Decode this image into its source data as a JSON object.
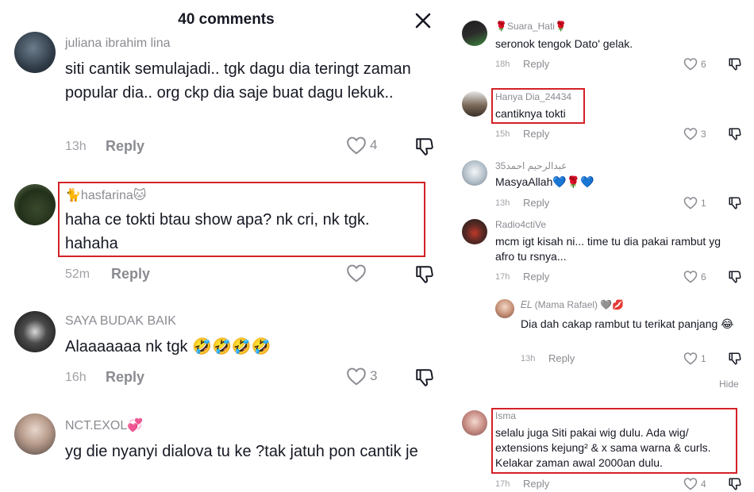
{
  "left": {
    "header_title": "40 comments",
    "comments": [
      {
        "username": "juliana ibrahim lina",
        "text": "siti cantik semulajadi.. tgk dagu dia teringt zaman popular dia.. org ckp dia saje buat dagu lekuk..",
        "time": "13h",
        "reply": "Reply",
        "likes": "4"
      },
      {
        "username": "🐈hasfarina🐱",
        "text": "haha ce tokti btau show apa? nk cri, nk tgk. hahaha",
        "time": "52m",
        "reply": "Reply",
        "likes": ""
      },
      {
        "username": "SAYA BUDAK BAIK",
        "text": "Alaaaaaaa nk tgk 🤣🤣🤣🤣",
        "time": "16h",
        "reply": "Reply",
        "likes": "3"
      },
      {
        "username": "NCT.EXOL💞",
        "text": "yg die nyanyi dialova tu ke ?tak jatuh pon cantik je",
        "time": "",
        "reply": "",
        "likes": ""
      }
    ]
  },
  "right": {
    "comments": [
      {
        "username": "🌹Suara_Hati🌹",
        "text": "seronok tengok Dato' gelak.",
        "time": "18h",
        "reply": "Reply",
        "likes": "6"
      },
      {
        "username": "Hanya Dia_24434",
        "text": "cantiknya tokti",
        "time": "15h",
        "reply": "Reply",
        "likes": "3"
      },
      {
        "username": "عبدالرحيم احمد35",
        "text": "MasyaAllah💙🌹💙",
        "time": "13h",
        "reply": "Reply",
        "likes": "1"
      },
      {
        "username": "Radio4ctiVe",
        "text": "mcm igt kisah ni... time tu dia pakai rambut yg afro tu rsnya...",
        "time": "17h",
        "reply": "Reply",
        "likes": "6"
      },
      {
        "username": "𝐸𝐿 (Mama Rafael) 🩶💋",
        "text": "Dia dah cakap rambut tu terikat panjang 😂",
        "time": "13h",
        "reply": "Reply",
        "likes": "1"
      },
      {
        "username": "Isma",
        "text": "selalu juga Siti pakai wig dulu. Ada wig/ extensions kejung² & x sama warna & curls. Kelakar zaman awal 2000an dulu.",
        "time": "17h",
        "reply": "Reply",
        "likes": "4"
      }
    ],
    "hide_label": "Hide"
  },
  "colors": {
    "highlight": "#d42127",
    "text": "#161823",
    "muted": "#8a8b91"
  }
}
